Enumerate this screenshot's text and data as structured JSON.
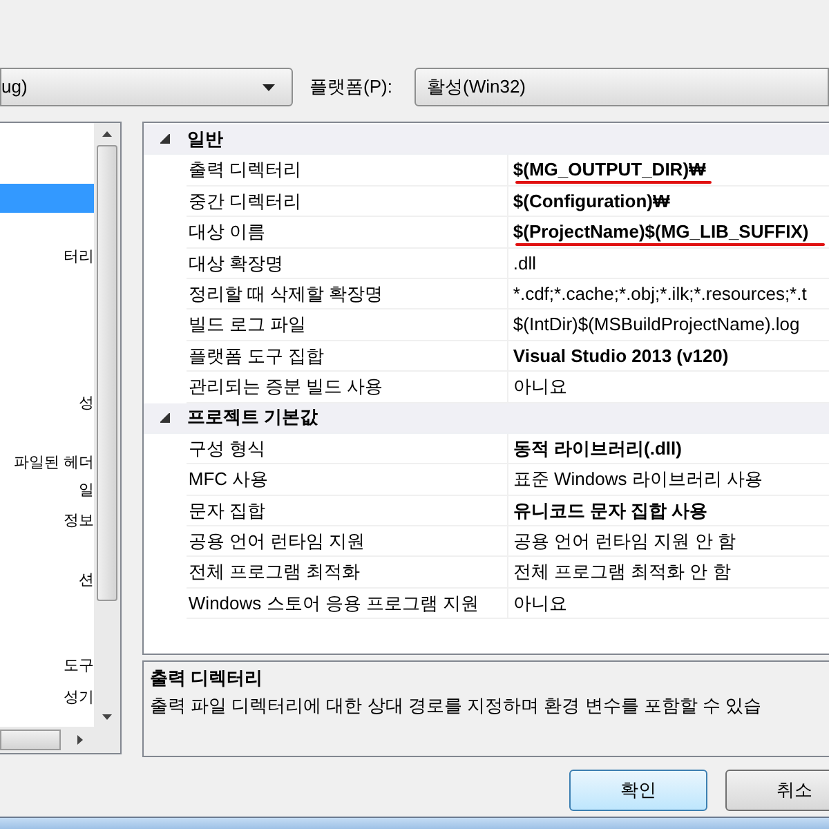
{
  "configuration_dropdown": {
    "value": "ug)"
  },
  "platform_label": "플랫폼(P):",
  "platform_dropdown": {
    "value": "활성(Win32)"
  },
  "tree": {
    "items": [
      {
        "selected": true
      },
      {
        "label": "터리",
        "selected": false
      },
      {
        "label": "성",
        "selected": false
      },
      {
        "label": "파일된 헤더",
        "selected": false
      },
      {
        "label": "일",
        "selected": false
      },
      {
        "label": "정보",
        "selected": false
      },
      {
        "label": "션",
        "selected": false
      },
      {
        "label": "도구",
        "selected": false
      },
      {
        "label": "성기",
        "selected": false
      }
    ]
  },
  "property_grid": {
    "sections": [
      {
        "title": "일반",
        "expanded": true,
        "rows": [
          {
            "name": "출력 디렉터리",
            "value": "$(MG_OUTPUT_DIR)₩",
            "bold": true,
            "underlined": true
          },
          {
            "name": "중간 디렉터리",
            "value": "$(Configuration)₩",
            "bold": true,
            "underlined": false
          },
          {
            "name": "대상 이름",
            "value": "$(ProjectName)$(MG_LIB_SUFFIX)",
            "bold": true,
            "underlined": true
          },
          {
            "name": "대상 확장명",
            "value": ".dll",
            "bold": false,
            "underlined": false
          },
          {
            "name": "정리할 때 삭제할 확장명",
            "value": "*.cdf;*.cache;*.obj;*.ilk;*.resources;*.t",
            "bold": false,
            "underlined": false
          },
          {
            "name": "빌드 로그 파일",
            "value": "$(IntDir)$(MSBuildProjectName).log",
            "bold": false,
            "underlined": false
          },
          {
            "name": "플랫폼 도구 집합",
            "value": "Visual Studio 2013 (v120)",
            "bold": true,
            "underlined": false
          },
          {
            "name": "관리되는 증분 빌드 사용",
            "value": "아니요",
            "bold": false,
            "underlined": false
          }
        ]
      },
      {
        "title": "프로젝트 기본값",
        "expanded": true,
        "rows": [
          {
            "name": "구성 형식",
            "value": "동적 라이브러리(.dll)",
            "bold": true,
            "underlined": false
          },
          {
            "name": "MFC 사용",
            "value": "표준 Windows 라이브러리 사용",
            "bold": false,
            "underlined": false
          },
          {
            "name": "문자 집합",
            "value": "유니코드 문자 집합 사용",
            "bold": true,
            "underlined": false
          },
          {
            "name": "공용 언어 런타임 지원",
            "value": "공용 언어 런타임 지원 안 함",
            "bold": false,
            "underlined": false
          },
          {
            "name": "전체 프로그램 최적화",
            "value": "전체 프로그램 최적화 안 함",
            "bold": false,
            "underlined": false
          },
          {
            "name": "Windows 스토어 응용 프로그램 지원",
            "value": "아니요",
            "bold": false,
            "underlined": false
          }
        ]
      }
    ]
  },
  "description": {
    "title": "출력 디렉터리",
    "text": "출력 파일 디렉터리에 대한 상대 경로를 지정하며 환경 변수를 포함할 수 있습"
  },
  "buttons": [
    {
      "label": "확인",
      "default": true
    },
    {
      "label": "취소",
      "default": false
    }
  ]
}
